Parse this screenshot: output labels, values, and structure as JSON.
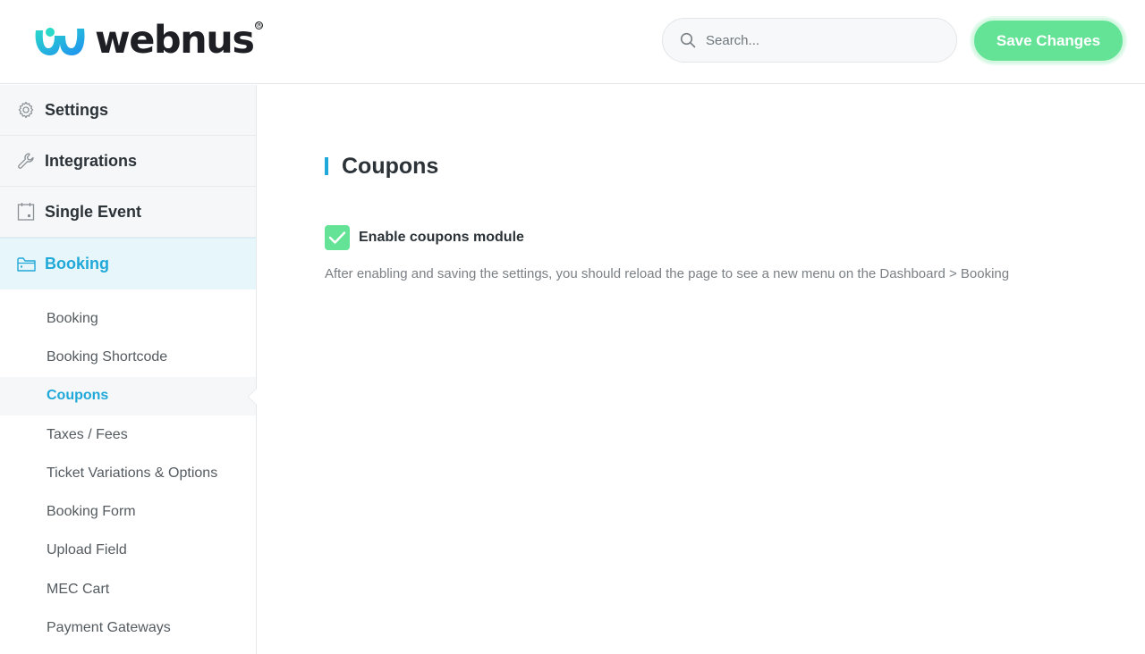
{
  "header": {
    "logo_text": "webnus",
    "logo_reg": "®",
    "search_placeholder": "Search...",
    "save_label": "Save Changes"
  },
  "sidebar": {
    "top_items": [
      {
        "label": "Settings",
        "icon": "gear-icon"
      },
      {
        "label": "Integrations",
        "icon": "wrench-icon"
      },
      {
        "label": "Single Event",
        "icon": "calendar-icon"
      },
      {
        "label": "Booking",
        "icon": "folder-icon",
        "active": true
      }
    ],
    "sub_items": [
      {
        "label": "Booking"
      },
      {
        "label": "Booking Shortcode"
      },
      {
        "label": "Coupons",
        "active": true
      },
      {
        "label": "Taxes / Fees"
      },
      {
        "label": "Ticket Variations & Options"
      },
      {
        "label": "Booking Form"
      },
      {
        "label": "Upload Field"
      },
      {
        "label": "MEC Cart"
      },
      {
        "label": "Payment Gateways"
      }
    ]
  },
  "main": {
    "title": "Coupons",
    "checkbox_label": "Enable coupons module",
    "checkbox_checked": true,
    "help_text": "After enabling and saving the settings, you should reload the page to see a new menu on the Dashboard > Booking"
  },
  "colors": {
    "accent": "#20a8d8",
    "save_green": "#64e396",
    "text_dark": "#2c3338",
    "text_muted": "#7a8085"
  }
}
